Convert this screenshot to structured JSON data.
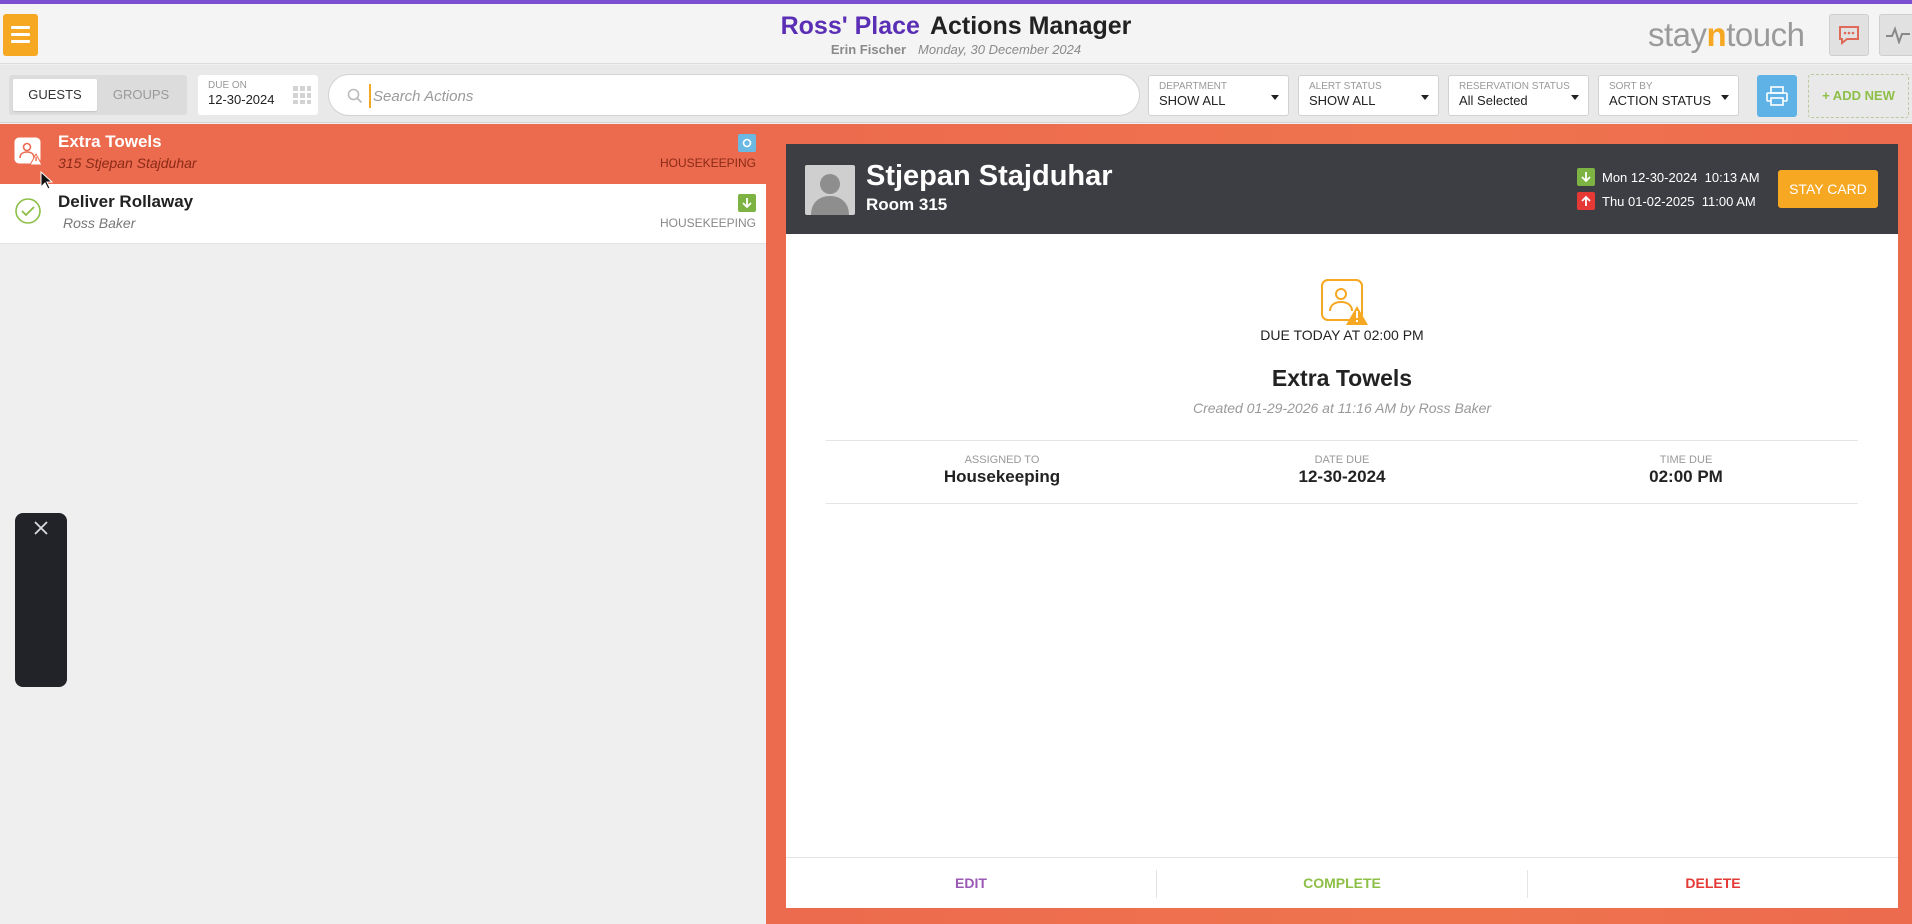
{
  "header": {
    "hotel_name": "Ross' Place",
    "page_title": "Actions Manager",
    "user_name": "Erin Fischer",
    "business_date": "Monday, 30 December 2024",
    "brand_prefix": "stay",
    "brand_accent": "n",
    "brand_suffix": "touch"
  },
  "filters": {
    "tabs": [
      {
        "label": "GUESTS",
        "active": true
      },
      {
        "label": "GROUPS",
        "active": false
      }
    ],
    "due_on": {
      "label": "DUE ON",
      "value": "12-30-2024"
    },
    "search_placeholder": "Search Actions",
    "department": {
      "label": "DEPARTMENT",
      "value": "SHOW ALL"
    },
    "alert_status": {
      "label": "ALERT STATUS",
      "value": "SHOW ALL"
    },
    "reservation_status": {
      "label": "RESERVATION STATUS",
      "value": "All Selected"
    },
    "sort_by": {
      "label": "SORT BY",
      "value": "ACTION STATUS"
    },
    "add_new_label": "+ ADD NEW"
  },
  "actions_list": [
    {
      "title": "Extra Towels",
      "subtitle": "315  Stjepan Stajduhar",
      "department": "HOUSEKEEPING",
      "status_icon": "alert-icon",
      "badge": "dot-icon",
      "selected": true
    },
    {
      "title": "Deliver Rollaway",
      "subtitle": "Ross Baker",
      "department": "HOUSEKEEPING",
      "status_icon": "check-icon",
      "badge": "arrival-icon",
      "selected": false
    }
  ],
  "detail": {
    "guest_name": "Stjepan Stajduhar",
    "room": "Room 315",
    "arrival": "Mon 12-30-2024  10:13 AM",
    "departure": "Thu 01-02-2025  11:00 AM",
    "stay_card_label": "STAY CARD",
    "due_text": "DUE TODAY AT 02:00 PM",
    "action_title": "Extra Towels",
    "created_text": "Created 01-29-2026 at 11:16 AM by Ross Baker",
    "assigned_to": {
      "label": "ASSIGNED TO",
      "value": "Housekeeping"
    },
    "date_due": {
      "label": "DATE DUE",
      "value": "12-30-2024"
    },
    "time_due": {
      "label": "TIME DUE",
      "value": "02:00 PM"
    },
    "edit_label": "EDIT",
    "complete_label": "COMPLETE",
    "delete_label": "DELETE"
  },
  "colors": {
    "top_border": "#7b4fd0",
    "hotel_name": "#5a2fb5",
    "accent_orange": "#f7a823",
    "selected_row": "#ec6a4e",
    "header_dark": "#3d3e43",
    "arrival_green": "#7cb342",
    "departure_red": "#e53935",
    "edit_purple": "#9b59b6",
    "complete_green": "#8dbf47",
    "delete_red": "#e53935",
    "print_blue": "#5fb2e6"
  }
}
